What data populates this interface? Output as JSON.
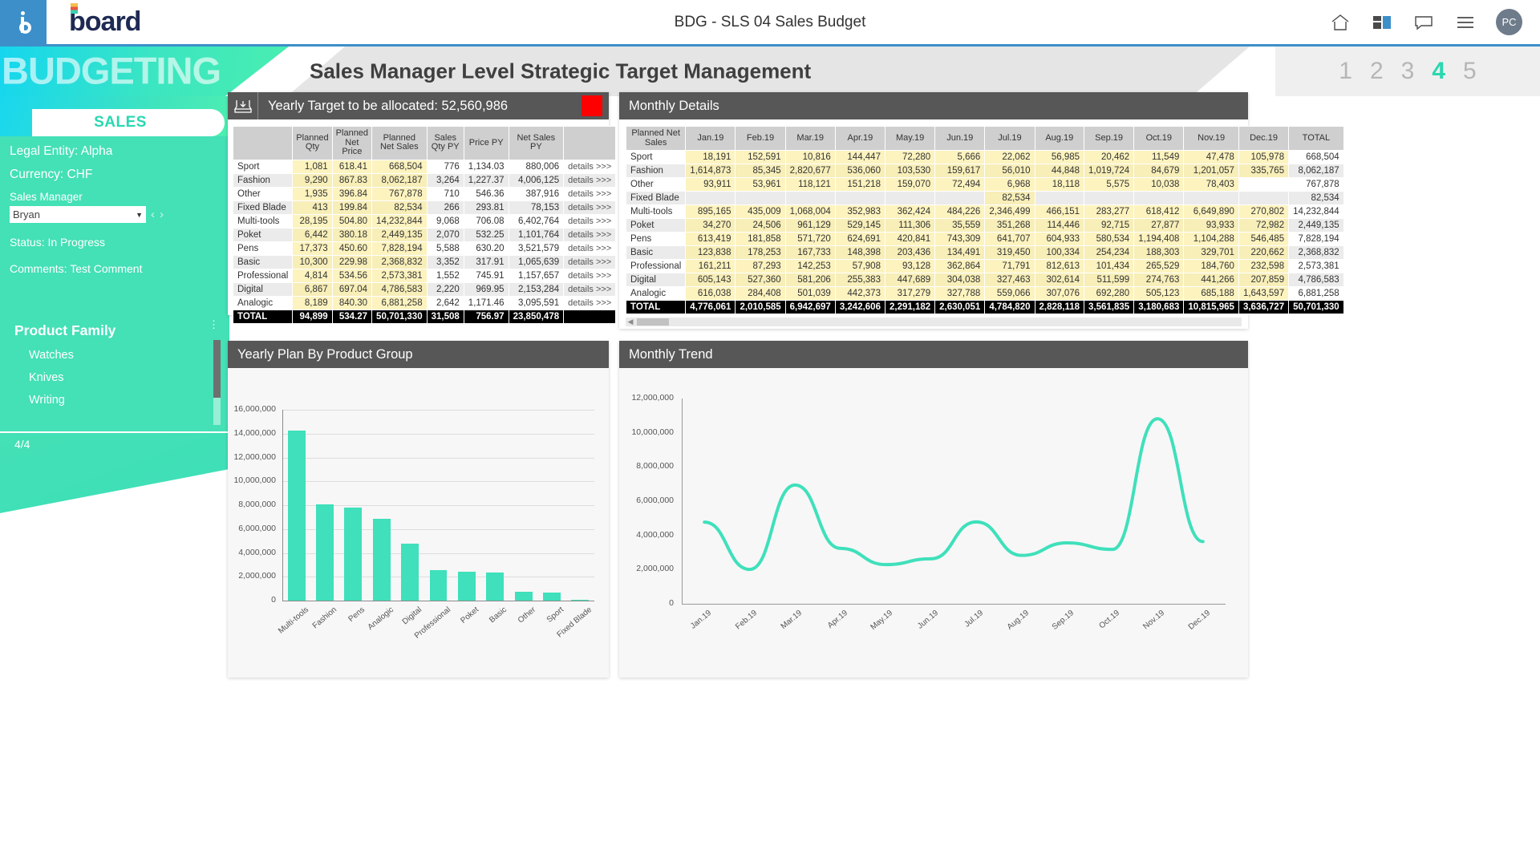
{
  "topbar": {
    "logo_text": "board",
    "title": "BDG - SLS 04 Sales Budget",
    "icons": [
      "home-icon",
      "dashboard-icon",
      "comment-icon",
      "menu-icon"
    ],
    "avatar_initials": "PC"
  },
  "banner": {
    "word": "BUDGETING",
    "title": "Sales Manager Level Strategic Target Management",
    "steps": [
      "1",
      "2",
      "3",
      "4",
      "5"
    ],
    "active_step": "4"
  },
  "sidebar": {
    "section_title": "SALES",
    "legal_entity": "Legal Entity: Alpha",
    "currency": "Currency:  CHF",
    "sales_manager_label": "Sales Manager",
    "sales_manager_value": "Bryan",
    "status": "Status:  In Progress",
    "comments": "Comments: Test Comment",
    "product_family_title": "Product Family",
    "product_family_items": [
      "Watches",
      "Knives",
      "Writing"
    ],
    "pager": "4/4"
  },
  "yearly_panel": {
    "title": "Yearly Target to be allocated:  52,560,986",
    "icon": "inbox-download-icon",
    "columns": [
      "",
      "Planned Qty",
      "Planned Net Price",
      "Planned Net Sales",
      "Sales Qty PY",
      "Price PY",
      "Net Sales PY",
      ""
    ],
    "detail_label": "details >>>",
    "rows": [
      [
        "Sport",
        "1,081",
        "618.41",
        "668,504",
        "776",
        "1,134.03",
        "880,006"
      ],
      [
        "Fashion",
        "9,290",
        "867.83",
        "8,062,187",
        "3,264",
        "1,227.37",
        "4,006,125"
      ],
      [
        "Other",
        "1,935",
        "396.84",
        "767,878",
        "710",
        "546.36",
        "387,916"
      ],
      [
        "Fixed Blade",
        "413",
        "199.84",
        "82,534",
        "266",
        "293.81",
        "78,153"
      ],
      [
        "Multi-tools",
        "28,195",
        "504.80",
        "14,232,844",
        "9,068",
        "706.08",
        "6,402,764"
      ],
      [
        "Poket",
        "6,442",
        "380.18",
        "2,449,135",
        "2,070",
        "532.25",
        "1,101,764"
      ],
      [
        "Pens",
        "17,373",
        "450.60",
        "7,828,194",
        "5,588",
        "630.20",
        "3,521,579"
      ],
      [
        "Basic",
        "10,300",
        "229.98",
        "2,368,832",
        "3,352",
        "317.91",
        "1,065,639"
      ],
      [
        "Professional",
        "4,814",
        "534.56",
        "2,573,381",
        "1,552",
        "745.91",
        "1,157,657"
      ],
      [
        "Digital",
        "6,867",
        "697.04",
        "4,786,583",
        "2,220",
        "969.95",
        "2,153,284"
      ],
      [
        "Analogic",
        "8,189",
        "840.30",
        "6,881,258",
        "2,642",
        "1,171.46",
        "3,095,591"
      ]
    ],
    "total_row": [
      "TOTAL",
      "94,899",
      "534.27",
      "50,701,330",
      "31,508",
      "756.97",
      "23,850,478"
    ]
  },
  "monthly_panel": {
    "title": "Monthly Details",
    "columns": [
      "Planned Net Sales",
      "Jan.19",
      "Feb.19",
      "Mar.19",
      "Apr.19",
      "May.19",
      "Jun.19",
      "Jul.19",
      "Aug.19",
      "Sep.19",
      "Oct.19",
      "Nov.19",
      "Dec.19",
      "TOTAL"
    ],
    "rows": [
      [
        "Sport",
        "18,191",
        "152,591",
        "10,816",
        "144,447",
        "72,280",
        "5,666",
        "22,062",
        "56,985",
        "20,462",
        "11,549",
        "47,478",
        "105,978",
        "668,504"
      ],
      [
        "Fashion",
        "1,614,873",
        "85,345",
        "2,820,677",
        "536,060",
        "103,530",
        "159,617",
        "56,010",
        "44,848",
        "1,019,724",
        "84,679",
        "1,201,057",
        "335,765",
        "8,062,187"
      ],
      [
        "Other",
        "93,911",
        "53,961",
        "118,121",
        "151,218",
        "159,070",
        "72,494",
        "6,968",
        "18,118",
        "5,575",
        "10,038",
        "78,403",
        "",
        "767,878"
      ],
      [
        "Fixed Blade",
        "",
        "",
        "",
        "",
        "",
        "",
        "82,534",
        "",
        "",
        "",
        "",
        "",
        "82,534"
      ],
      [
        "Multi-tools",
        "895,165",
        "435,009",
        "1,068,004",
        "352,983",
        "362,424",
        "484,226",
        "2,346,499",
        "466,151",
        "283,277",
        "618,412",
        "6,649,890",
        "270,802",
        "14,232,844"
      ],
      [
        "Poket",
        "34,270",
        "24,506",
        "961,129",
        "529,145",
        "111,306",
        "35,559",
        "351,268",
        "114,446",
        "92,715",
        "27,877",
        "93,933",
        "72,982",
        "2,449,135"
      ],
      [
        "Pens",
        "613,419",
        "181,858",
        "571,720",
        "624,691",
        "420,841",
        "743,309",
        "641,707",
        "604,933",
        "580,534",
        "1,194,408",
        "1,104,288",
        "546,485",
        "7,828,194"
      ],
      [
        "Basic",
        "123,838",
        "178,253",
        "167,733",
        "148,398",
        "203,436",
        "134,491",
        "319,450",
        "100,334",
        "254,234",
        "188,303",
        "329,701",
        "220,662",
        "2,368,832"
      ],
      [
        "Professional",
        "161,211",
        "87,293",
        "142,253",
        "57,908",
        "93,128",
        "362,864",
        "71,791",
        "812,613",
        "101,434",
        "265,529",
        "184,760",
        "232,598",
        "2,573,381"
      ],
      [
        "Digital",
        "605,143",
        "527,360",
        "581,206",
        "255,383",
        "447,689",
        "304,038",
        "327,463",
        "302,614",
        "511,599",
        "274,763",
        "441,266",
        "207,859",
        "4,786,583"
      ],
      [
        "Analogic",
        "616,038",
        "284,408",
        "501,039",
        "442,373",
        "317,279",
        "327,788",
        "559,066",
        "307,076",
        "692,280",
        "505,123",
        "685,188",
        "1,643,597",
        "6,881,258"
      ]
    ],
    "total_row": [
      "TOTAL",
      "4,776,061",
      "2,010,585",
      "6,942,697",
      "3,242,606",
      "2,291,182",
      "2,630,051",
      "4,784,820",
      "2,828,118",
      "3,561,835",
      "3,180,683",
      "10,815,965",
      "3,636,727",
      "50,701,330"
    ]
  },
  "chart_data": [
    {
      "type": "bar",
      "title": "Yearly Plan By Product Group",
      "categories": [
        "Multi-tools",
        "Fashion",
        "Pens",
        "Analogic",
        "Digital",
        "Professional",
        "Poket",
        "Basic",
        "Other",
        "Sport",
        "Fixed Blade"
      ],
      "values": [
        14232844,
        8062187,
        7828194,
        6881258,
        4786583,
        2573381,
        2449135,
        2368832,
        767878,
        668504,
        82534
      ],
      "xlabel": "",
      "ylabel": "",
      "ylim": [
        0,
        16000000
      ],
      "yticks": [
        "0",
        "2,000,000",
        "4,000,000",
        "6,000,000",
        "8,000,000",
        "10,000,000",
        "12,000,000",
        "14,000,000",
        "16,000,000"
      ],
      "grid": true,
      "legend": "none",
      "series_color": "#3fe0bb"
    },
    {
      "type": "line",
      "title": "Monthly Trend",
      "categories": [
        "Jan.19",
        "Feb.19",
        "Mar.19",
        "Apr.19",
        "May.19",
        "Jun.19",
        "Jul.19",
        "Aug.19",
        "Sep.19",
        "Oct.19",
        "Nov.19",
        "Dec.19"
      ],
      "values": [
        4776061,
        2010585,
        6942697,
        3242606,
        2291182,
        2630051,
        4784820,
        2828118,
        3561835,
        3180683,
        10815965,
        3636727
      ],
      "xlabel": "",
      "ylabel": "",
      "ylim": [
        0,
        12000000
      ],
      "yticks": [
        "0",
        "2,000,000",
        "4,000,000",
        "6,000,000",
        "8,000,000",
        "10,000,000",
        "12,000,000"
      ],
      "grid": false,
      "legend": "none",
      "series_color": "#3fe0bb"
    }
  ]
}
